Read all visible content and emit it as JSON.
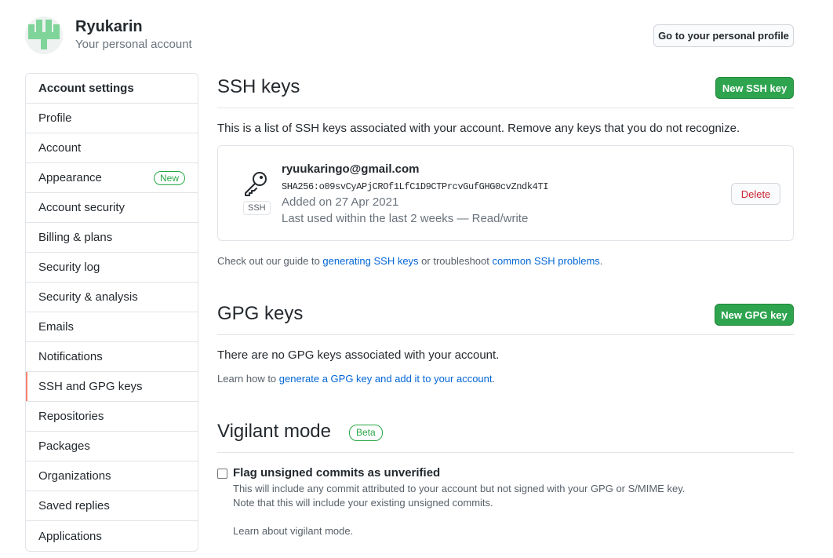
{
  "header": {
    "user_name": "Ryukarin",
    "user_subtitle": "Your personal account",
    "profile_button": "Go to your personal profile"
  },
  "sidebar": {
    "heading": "Account settings",
    "items": [
      {
        "label": "Profile"
      },
      {
        "label": "Account"
      },
      {
        "label": "Appearance",
        "badge": "New"
      },
      {
        "label": "Account security"
      },
      {
        "label": "Billing & plans"
      },
      {
        "label": "Security log"
      },
      {
        "label": "Security & analysis"
      },
      {
        "label": "Emails"
      },
      {
        "label": "Notifications"
      },
      {
        "label": "SSH and GPG keys",
        "selected": true
      },
      {
        "label": "Repositories"
      },
      {
        "label": "Packages"
      },
      {
        "label": "Organizations"
      },
      {
        "label": "Saved replies"
      },
      {
        "label": "Applications"
      }
    ]
  },
  "ssh": {
    "title": "SSH keys",
    "new_button": "New SSH key",
    "description": "This is a list of SSH keys associated with your account. Remove any keys that you do not recognize.",
    "key": {
      "type_label": "SSH",
      "title": "ryuukaringo@gmail.com",
      "fingerprint": "SHA256:o09svCyAPjCROf1LfC1D9CTPrcvGufGHG0cvZndk4TI",
      "added": "Added on 27 Apr 2021",
      "last_used": "Last used within the last 2 weeks — Read/write",
      "delete_button": "Delete"
    },
    "guide_prefix": "Check out our guide to ",
    "guide_link1": "generating SSH keys",
    "guide_middle": " or troubleshoot ",
    "guide_link2": "common SSH problems",
    "guide_suffix": "."
  },
  "gpg": {
    "title": "GPG keys",
    "new_button": "New GPG key",
    "empty_text": "There are no GPG keys associated with your account.",
    "learn_prefix": "Learn how to ",
    "learn_link": "generate a GPG key and add it to your account",
    "learn_suffix": "."
  },
  "vigilant": {
    "title": "Vigilant mode",
    "badge": "Beta",
    "checkbox_label": "Flag unsigned commits as unverified",
    "desc_line1": "This will include any commit attributed to your account but not signed with your GPG or S/MIME key.",
    "desc_line2": "Note that this will include your existing unsigned commits.",
    "learn_link": "Learn about vigilant mode."
  },
  "colors": {
    "accent_green": "#2ea44f",
    "link_blue": "#0366d6",
    "danger_red": "#cb2431",
    "selected_marker": "#f9826c",
    "avatar_green": "#7fd49a"
  },
  "icons": {
    "avatar": "identicon-avatar",
    "key": "key-icon"
  }
}
